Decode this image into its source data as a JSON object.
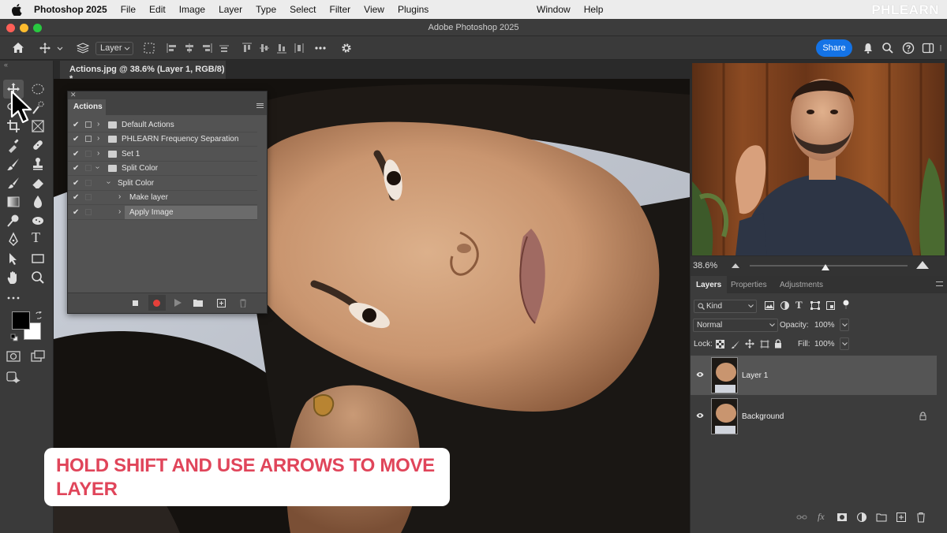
{
  "menubar": {
    "app_name": "Photoshop 2025",
    "items": [
      "File",
      "Edit",
      "Image",
      "Layer",
      "Type",
      "Select",
      "Filter",
      "View",
      "Plugins"
    ],
    "right_items": [
      "Window",
      "Help"
    ],
    "watermark": "PHLEARN"
  },
  "window": {
    "title": "Adobe Photoshop 2025"
  },
  "options_bar": {
    "layer_select": "Layer",
    "share_label": "Share"
  },
  "document": {
    "tab_title": "Actions.jpg @ 38.6% (Layer 1, RGB/8) *"
  },
  "actions_panel": {
    "title": "Actions",
    "rows": [
      {
        "label": "Default Actions",
        "checked": true,
        "dialog": "on",
        "expanded": false,
        "type": "set"
      },
      {
        "label": "PHLEARN Frequency Separation",
        "checked": true,
        "dialog": "on",
        "expanded": false,
        "type": "set"
      },
      {
        "label": "Set 1",
        "checked": true,
        "dialog": "off",
        "expanded": false,
        "type": "set"
      },
      {
        "label": "Split Color",
        "checked": true,
        "dialog": "off",
        "expanded": true,
        "type": "set"
      },
      {
        "label": "Split Color",
        "checked": true,
        "dialog": "off",
        "expanded": true,
        "type": "action"
      },
      {
        "label": "Make layer",
        "checked": true,
        "dialog": "off",
        "expanded": false,
        "type": "step"
      },
      {
        "label": "Apply Image",
        "checked": true,
        "dialog": "off",
        "expanded": false,
        "type": "step",
        "selected": true
      }
    ]
  },
  "caption": {
    "line1": "HOLD SHIFT AND USE ARROWS TO MOVE",
    "line2": "LAYER"
  },
  "navigator": {
    "zoom": "38.6%",
    "zoom_level": 0.48
  },
  "panel_tabs": [
    "Layers",
    "Properties",
    "Adjustments"
  ],
  "layers_panel": {
    "filter_kind": "Kind",
    "blend_mode": "Normal",
    "opacity_label": "Opacity:",
    "opacity_value": "100%",
    "lock_label": "Lock:",
    "fill_label": "Fill:",
    "fill_value": "100%",
    "layers": [
      {
        "name": "Layer 1",
        "visible": true,
        "selected": true,
        "locked": false
      },
      {
        "name": "Background",
        "visible": true,
        "selected": false,
        "locked": true
      }
    ]
  },
  "colors": {
    "accent": "#1473e6",
    "record": "#e5403a",
    "caption_text": "#e0455a"
  }
}
